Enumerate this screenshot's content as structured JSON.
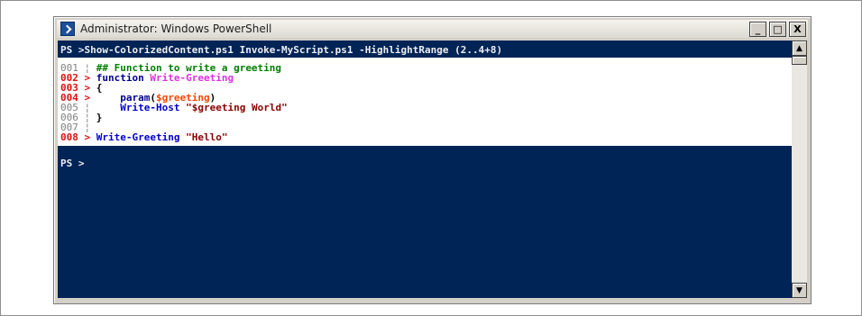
{
  "window": {
    "title": "Administrator: Windows PowerShell",
    "buttons": {
      "minimize": "_",
      "maximize": "□",
      "close": "X"
    }
  },
  "console": {
    "command_line": "PS >Show-ColorizedContent.ps1 Invoke-MyScript.ps1 -HighlightRange (2..4+8)",
    "lines": [
      {
        "num": "001",
        "gutter": "¦",
        "highlighted": false,
        "tokens": [
          {
            "t": "## Function to write a greeting",
            "k": "comment"
          }
        ]
      },
      {
        "num": "002",
        "gutter": ">",
        "highlighted": true,
        "tokens": [
          {
            "t": "function ",
            "k": "keyword"
          },
          {
            "t": "Write-Greeting",
            "k": "function"
          }
        ]
      },
      {
        "num": "003",
        "gutter": ">",
        "highlighted": true,
        "tokens": [
          {
            "t": "{",
            "k": "plain"
          }
        ]
      },
      {
        "num": "004",
        "gutter": ">",
        "highlighted": true,
        "tokens": [
          {
            "t": "    ",
            "k": "plain"
          },
          {
            "t": "param",
            "k": "keyword"
          },
          {
            "t": "(",
            "k": "plain"
          },
          {
            "t": "$greeting",
            "k": "variable"
          },
          {
            "t": ")",
            "k": "plain"
          }
        ]
      },
      {
        "num": "005",
        "gutter": "¦",
        "highlighted": false,
        "tokens": [
          {
            "t": "    ",
            "k": "plain"
          },
          {
            "t": "Write-Host",
            "k": "command"
          },
          {
            "t": " ",
            "k": "plain"
          },
          {
            "t": "\"$greeting World\"",
            "k": "string"
          }
        ]
      },
      {
        "num": "006",
        "gutter": "¦",
        "highlighted": false,
        "tokens": [
          {
            "t": "}",
            "k": "plain"
          }
        ]
      },
      {
        "num": "007",
        "gutter": "¦",
        "highlighted": false,
        "tokens": []
      },
      {
        "num": "008",
        "gutter": ">",
        "highlighted": true,
        "tokens": [
          {
            "t": "Write-Greeting",
            "k": "command"
          },
          {
            "t": " ",
            "k": "plain"
          },
          {
            "t": "\"Hello\"",
            "k": "string"
          }
        ]
      }
    ],
    "prompt": "PS >"
  },
  "scrollbar": {
    "up_arrow": "▲",
    "down_arrow": "▼"
  },
  "colors": {
    "console_background": "#012456",
    "highlight_line_number": "#e01010",
    "comment": "#008000",
    "function_name": "#e030e0",
    "string": "#8b0000",
    "variable": "#ff4500"
  }
}
